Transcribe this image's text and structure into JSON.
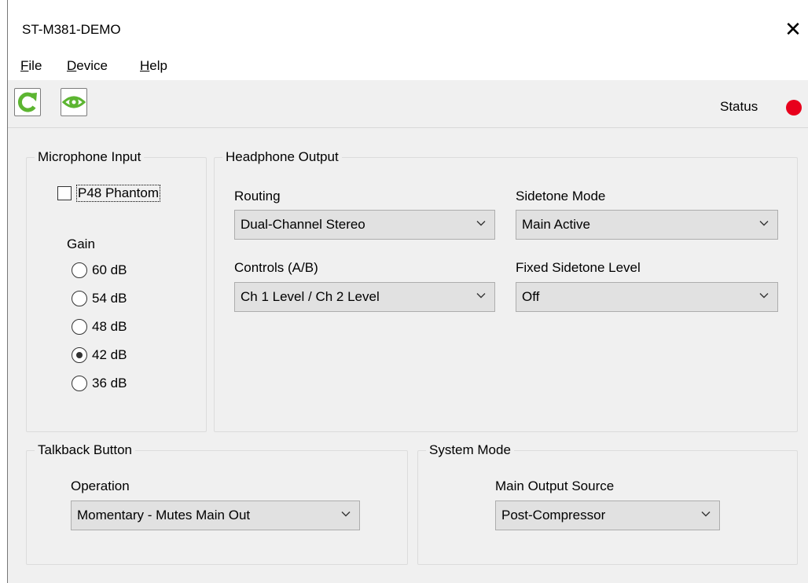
{
  "window": {
    "title": "ST-M381-DEMO",
    "close_glyph": "✕"
  },
  "menu": {
    "file": {
      "accel": "F",
      "rest": "ile"
    },
    "device": {
      "accel": "D",
      "rest": "evice"
    },
    "help": {
      "accel": "H",
      "rest": "elp"
    }
  },
  "toolbar": {
    "refresh_icon": "refresh-icon",
    "view_icon": "eye-icon",
    "status_label": "Status",
    "status_color": "#e8001c",
    "accent_green": "#5cb531"
  },
  "microphone_input": {
    "legend": "Microphone Input",
    "phantom_label": "P48 Phantom",
    "phantom_checked": false,
    "gain_label": "Gain",
    "gain_options": [
      "60 dB",
      "54 dB",
      "48 dB",
      "42 dB",
      "36 dB"
    ],
    "gain_selected": "42 dB"
  },
  "headphone_output": {
    "legend": "Headphone Output",
    "routing_label": "Routing",
    "routing_value": "Dual-Channel Stereo",
    "sidetone_mode_label": "Sidetone Mode",
    "sidetone_mode_value": "Main Active",
    "controls_label": "Controls (A/B)",
    "controls_value": "Ch 1 Level / Ch 2 Level",
    "fixed_sidetone_label": "Fixed Sidetone Level",
    "fixed_sidetone_value": "Off"
  },
  "talkback_button": {
    "legend": "Talkback Button",
    "operation_label": "Operation",
    "operation_value": "Momentary - Mutes Main Out"
  },
  "system_mode": {
    "legend": "System Mode",
    "main_output_source_label": "Main Output Source",
    "main_output_source_value": "Post-Compressor"
  }
}
